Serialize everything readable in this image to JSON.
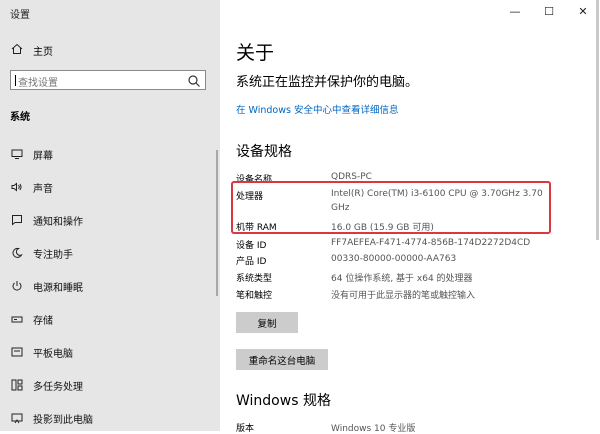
{
  "window": {
    "title": "设置",
    "minimize": "—",
    "maximize": "☐",
    "close": "✕"
  },
  "sidebar": {
    "home": {
      "label": "主页",
      "icon": "home-icon"
    },
    "search": {
      "placeholder": "查找设置",
      "icon": "search-icon"
    },
    "section": "系统",
    "items": [
      {
        "label": "屏幕",
        "icon": "display-icon"
      },
      {
        "label": "声音",
        "icon": "sound-icon"
      },
      {
        "label": "通知和操作",
        "icon": "notification-icon"
      },
      {
        "label": "专注助手",
        "icon": "moon-icon"
      },
      {
        "label": "电源和睡眠",
        "icon": "power-icon"
      },
      {
        "label": "存储",
        "icon": "storage-icon"
      },
      {
        "label": "平板电脑",
        "icon": "tablet-icon"
      },
      {
        "label": "多任务处理",
        "icon": "multitask-icon"
      },
      {
        "label": "投影到此电脑",
        "icon": "project-icon"
      }
    ]
  },
  "main": {
    "title": "关于",
    "status": "系统正在监控并保护你的电脑。",
    "security_link": "在 Windows 安全中心中查看详细信息",
    "device_spec_title": "设备规格",
    "specs": [
      {
        "label": "设备名称",
        "value": "QDRS-PC"
      },
      {
        "label": "处理器",
        "value": "Intel(R) Core(TM) i3-6100 CPU @ 3.70GHz   3.70",
        "value2": "GHz"
      },
      {
        "label": "机带 RAM",
        "value": "16.0 GB (15.9 GB 可用)"
      },
      {
        "label": "设备 ID",
        "value": "FF7AEFEA-F471-4774-856B-174D2272D4CD"
      },
      {
        "label": "产品 ID",
        "value": "00330-80000-00000-AA763"
      },
      {
        "label": "系统类型",
        "value": "64 位操作系统, 基于 x64 的处理器"
      },
      {
        "label": "笔和触控",
        "value": "没有可用于此显示器的笔或触控输入"
      }
    ],
    "copy_button": "复制",
    "rename_button": "重命名这台电脑",
    "windows_spec_title": "Windows 规格",
    "windows_specs": [
      {
        "label": "版本",
        "value": "Windows 10 专业版"
      }
    ],
    "highlight_color": "#d9383f",
    "link_color": "#0067c0"
  }
}
